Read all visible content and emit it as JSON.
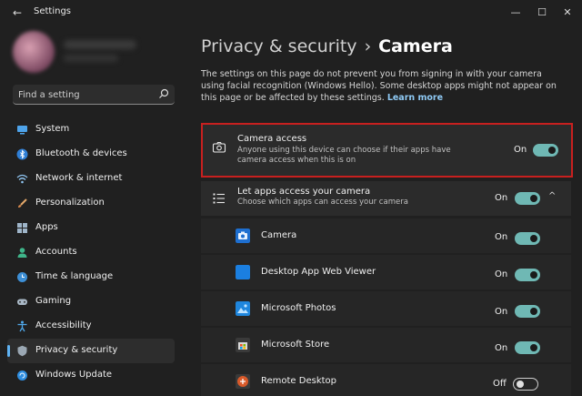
{
  "window": {
    "title": "Settings",
    "back_glyph": "←",
    "min_glyph": "—",
    "max_glyph": "☐",
    "close_glyph": "✕"
  },
  "search": {
    "placeholder": "Find a setting"
  },
  "sidebar": {
    "items": [
      {
        "label": "System",
        "icon": "monitor-icon"
      },
      {
        "label": "Bluetooth & devices",
        "icon": "bluetooth-icon"
      },
      {
        "label": "Network & internet",
        "icon": "wifi-icon"
      },
      {
        "label": "Personalization",
        "icon": "brush-icon"
      },
      {
        "label": "Apps",
        "icon": "apps-icon"
      },
      {
        "label": "Accounts",
        "icon": "person-icon"
      },
      {
        "label": "Time & language",
        "icon": "globe-clock-icon"
      },
      {
        "label": "Gaming",
        "icon": "gamepad-icon"
      },
      {
        "label": "Accessibility",
        "icon": "accessibility-icon"
      },
      {
        "label": "Privacy & security",
        "icon": "shield-icon",
        "selected": true
      },
      {
        "label": "Windows Update",
        "icon": "update-icon"
      }
    ]
  },
  "header": {
    "parent": "Privacy & security",
    "separator": "›",
    "current": "Camera"
  },
  "description": {
    "text": "The settings on this page do not prevent you from signing in with your camera using facial recognition (Windows Hello). Some desktop apps might not appear on this page or be affected by these settings.",
    "link": "Learn more"
  },
  "camera_access": {
    "title": "Camera access",
    "subtitle": "Anyone using this device can choose if their apps have camera access when this is on",
    "state_label": "On",
    "on": true
  },
  "let_apps": {
    "title": "Let apps access your camera",
    "subtitle": "Choose which apps can access your camera",
    "state_label": "On",
    "on": true,
    "chevron": "^"
  },
  "apps": [
    {
      "name": "Camera",
      "state_label": "On",
      "on": true,
      "icon": "camera-app-icon",
      "color": "#1e6fd0"
    },
    {
      "name": "Desktop App Web Viewer",
      "state_label": "On",
      "on": true,
      "icon": "web-viewer-icon",
      "color": "#1b7fe0"
    },
    {
      "name": "Microsoft Photos",
      "state_label": "On",
      "on": true,
      "icon": "photos-icon",
      "color": "#1f86dd"
    },
    {
      "name": "Microsoft Store",
      "state_label": "On",
      "on": true,
      "icon": "store-icon",
      "color": "#3a3a3a"
    },
    {
      "name": "Remote Desktop",
      "state_label": "Off",
      "on": false,
      "icon": "remote-desktop-icon",
      "color": "#d95a2a"
    }
  ],
  "colors": {
    "accent": "#5fb2f2",
    "toggle_on": "#6fb8b4",
    "highlight": "#c8201f"
  }
}
